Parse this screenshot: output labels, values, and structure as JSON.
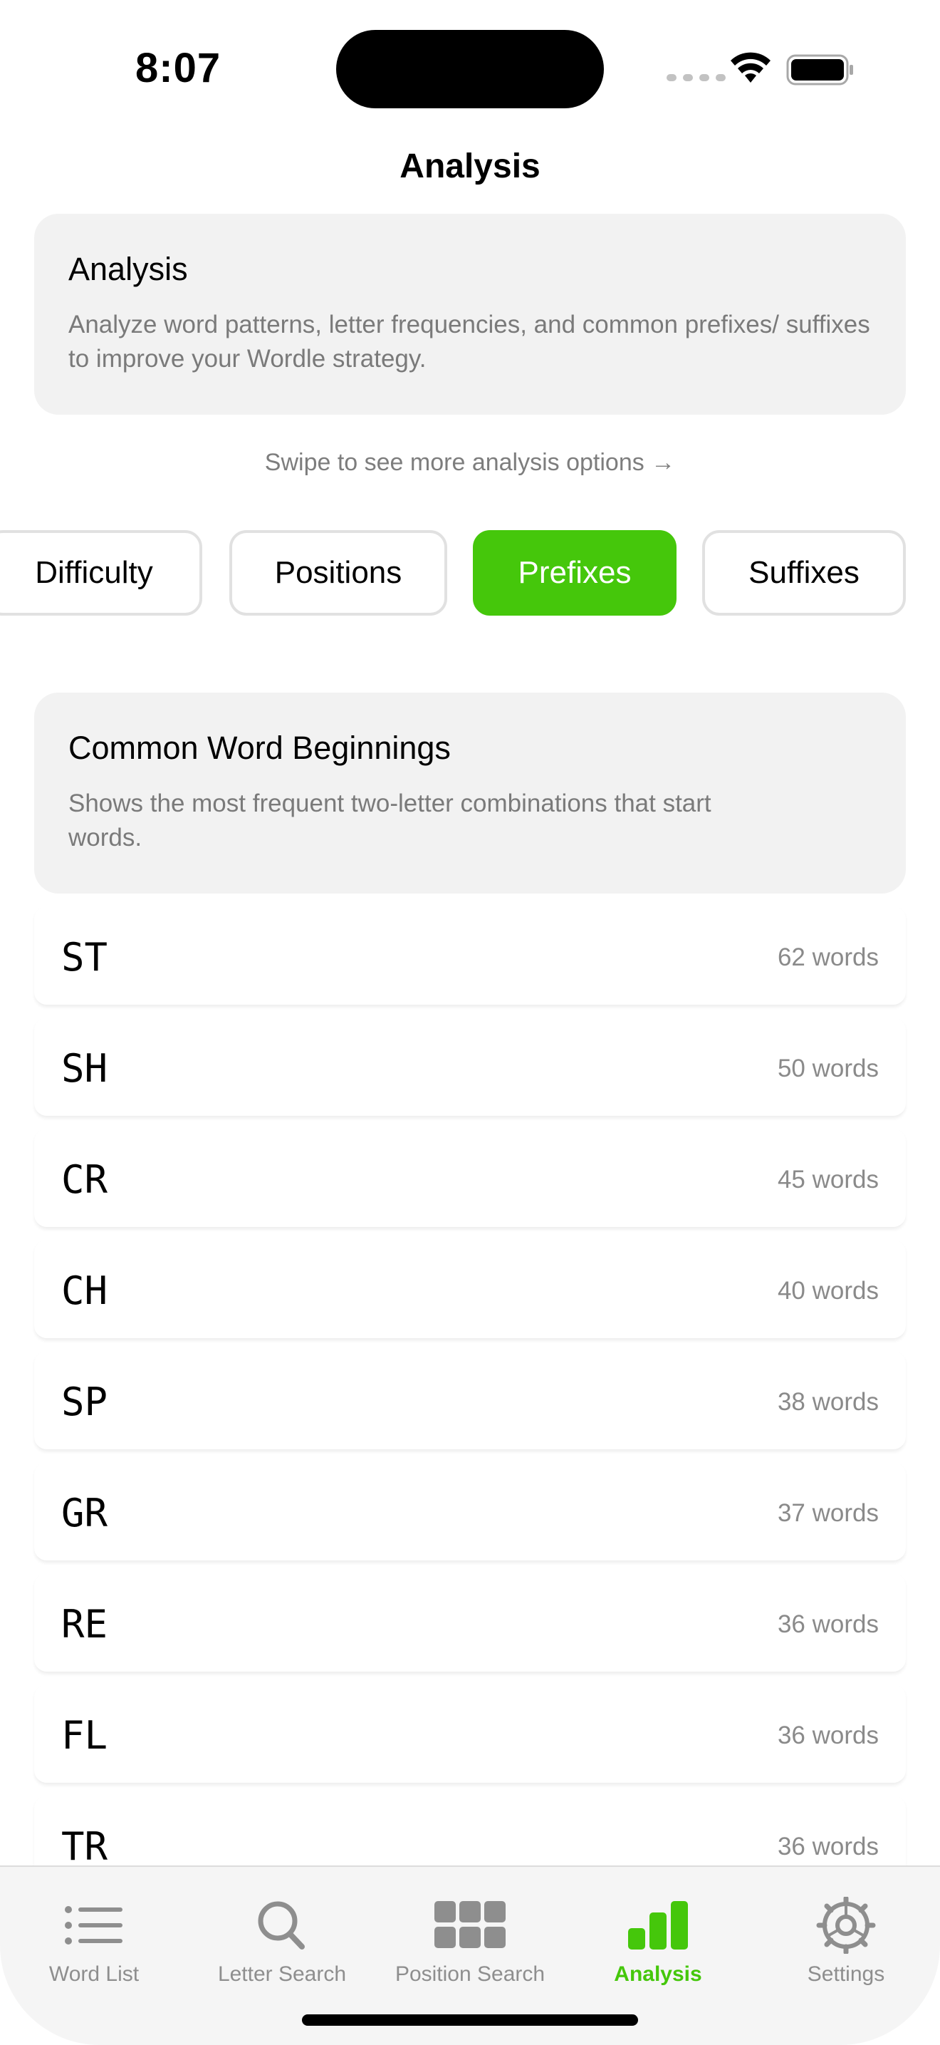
{
  "status_bar": {
    "time": "8:07"
  },
  "nav": {
    "title": "Analysis"
  },
  "analysis_card": {
    "title": "Analysis",
    "description": "Analyze word patterns, letter frequencies, and common prefixes/ suffixes to improve your Wordle strategy."
  },
  "swipe_hint": "Swipe to see more analysis options →",
  "segments": {
    "selected": "Prefixes",
    "items": [
      {
        "label": "Difficulty"
      },
      {
        "label": "Positions"
      },
      {
        "label": "Prefixes"
      },
      {
        "label": "Suffixes"
      }
    ]
  },
  "prefix_card": {
    "title": "Common Word Beginnings",
    "description": "Shows the most frequent two-letter combinations that start words."
  },
  "prefixes": [
    {
      "prefix": "ST",
      "count": "62 words"
    },
    {
      "prefix": "SH",
      "count": "50 words"
    },
    {
      "prefix": "CR",
      "count": "45 words"
    },
    {
      "prefix": "CH",
      "count": "40 words"
    },
    {
      "prefix": "SP",
      "count": "38 words"
    },
    {
      "prefix": "GR",
      "count": "37 words"
    },
    {
      "prefix": "RE",
      "count": "36 words"
    },
    {
      "prefix": "FL",
      "count": "36 words"
    },
    {
      "prefix": "TR",
      "count": "36 words"
    }
  ],
  "tab_bar": {
    "selected": "Analysis",
    "items": [
      {
        "label": "Word List",
        "icon": "list-icon"
      },
      {
        "label": "Letter Search",
        "icon": "search-icon"
      },
      {
        "label": "Position Search",
        "icon": "grid-icon"
      },
      {
        "label": "Analysis",
        "icon": "bar-chart-icon"
      },
      {
        "label": "Settings",
        "icon": "gear-icon"
      }
    ]
  },
  "colors": {
    "accent": "#45c70b",
    "card_background": "#f2f2f2",
    "secondary_text": "#7a7a7a",
    "inactive_tab": "#8e8e8e"
  }
}
